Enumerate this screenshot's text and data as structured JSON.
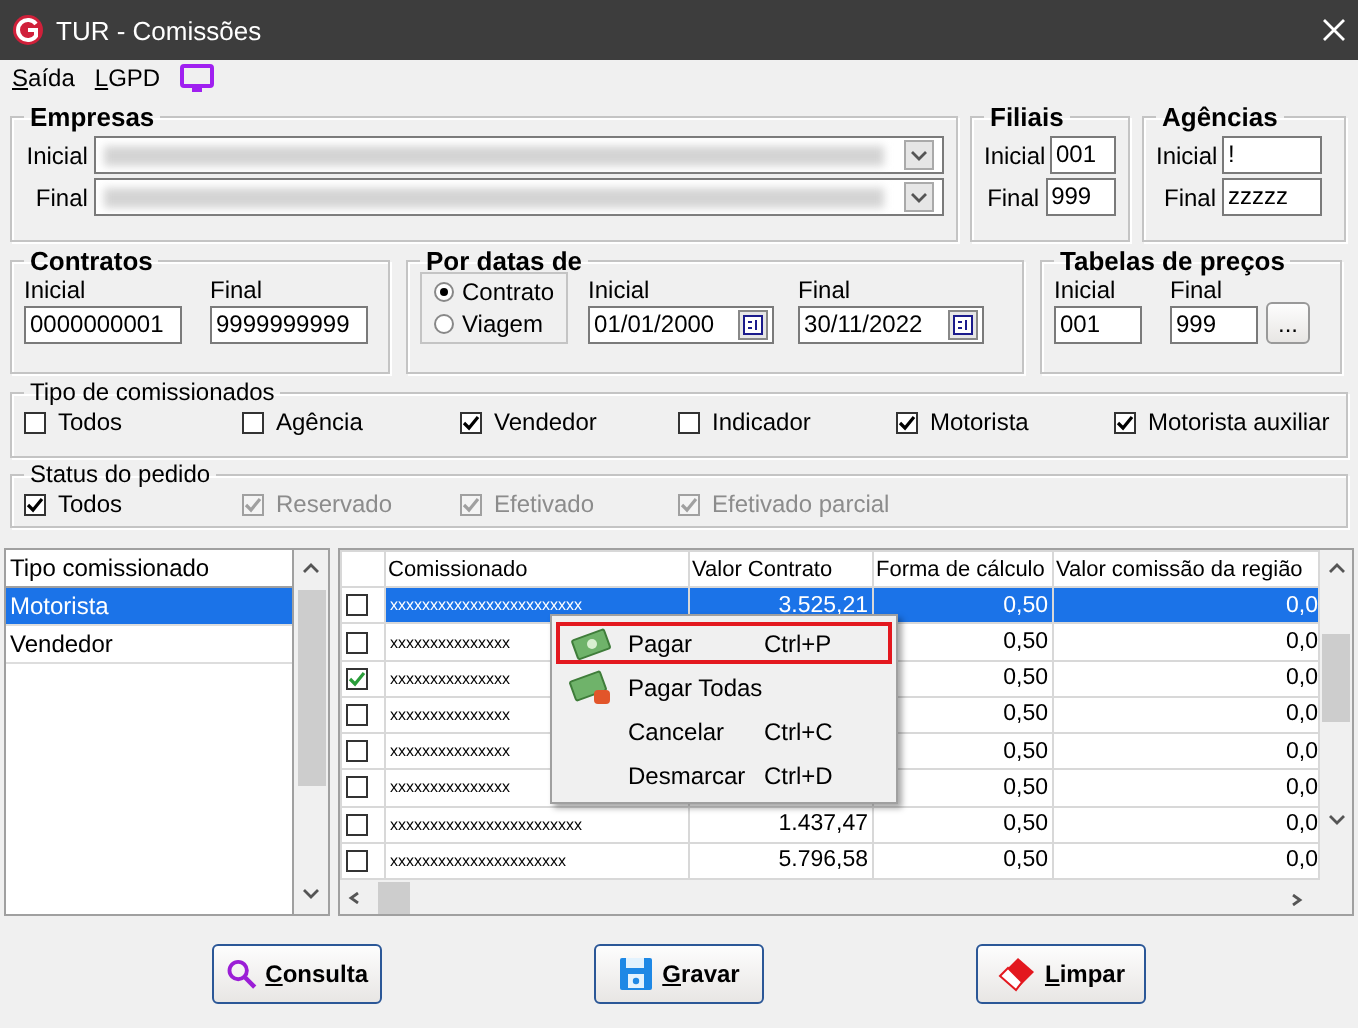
{
  "window": {
    "title": "TUR - Comissões"
  },
  "menu": [
    {
      "label": "Saída"
    },
    {
      "label": "LGPD"
    }
  ],
  "empresas": {
    "title": "Empresas",
    "fields": [
      {
        "label": "Inicial"
      },
      {
        "label": "Final"
      }
    ]
  },
  "filiais": {
    "title": "Filiais",
    "fields": [
      {
        "label": "Inicial",
        "value": "001"
      },
      {
        "label": "Final",
        "value": "999"
      }
    ]
  },
  "agencias": {
    "title": "Agências",
    "fields": [
      {
        "label": "Inicial",
        "value": "!"
      },
      {
        "label": "Final",
        "value": "zzzzz"
      }
    ]
  },
  "contratos": {
    "title": "Contratos",
    "fields": [
      {
        "label": "Inicial",
        "value": "0000000001"
      },
      {
        "label": "Final",
        "value": "9999999999"
      }
    ]
  },
  "por_datas": {
    "title": "Por datas de",
    "options": [
      {
        "label": "Contrato",
        "selected": true
      },
      {
        "label": "Viagem",
        "selected": false
      }
    ],
    "fields": [
      {
        "label": "Inicial",
        "value": "01/01/2000"
      },
      {
        "label": "Final",
        "value": "30/11/2022"
      }
    ]
  },
  "tabelas": {
    "title": "Tabelas de preços",
    "fields": [
      {
        "label": "Inicial",
        "value": "001"
      },
      {
        "label": "Final",
        "value": "999"
      }
    ],
    "button": "..."
  },
  "tipo": {
    "title": "Tipo de comissionados",
    "options": [
      {
        "label": "Todos",
        "checked": false
      },
      {
        "label": "Agência",
        "checked": false
      },
      {
        "label": "Vendedor",
        "checked": true
      },
      {
        "label": "Indicador",
        "checked": false
      },
      {
        "label": "Motorista",
        "checked": true
      },
      {
        "label": "Motorista auxiliar",
        "checked": true
      }
    ]
  },
  "status": {
    "title": "Status do pedido",
    "options": [
      {
        "label": "Todos",
        "checked": true,
        "disabled": false
      },
      {
        "label": "Reservado",
        "checked": true,
        "disabled": true
      },
      {
        "label": "Efetivado",
        "checked": true,
        "disabled": true
      },
      {
        "label": "Efetivado parcial",
        "checked": true,
        "disabled": true
      }
    ]
  },
  "left_list": {
    "header": "Tipo comissionado",
    "items": [
      {
        "label": "Motorista",
        "selected": true
      },
      {
        "label": "Vendedor",
        "selected": false
      }
    ]
  },
  "grid": {
    "columns": [
      "Comissionado",
      "Valor Contrato",
      "Forma de cálculo",
      "Valor comissão da região"
    ],
    "rows": [
      {
        "checked": false,
        "selected": true,
        "comissionado": "xxxxxxxxxxxxxxxxxxxxxxxx",
        "valor": "3.525,21",
        "forma": "0,50",
        "regiao": "0,0"
      },
      {
        "checked": false,
        "selected": false,
        "comissionado": "xxxxxxxxxxxxxxx",
        "forma": "0,50",
        "regiao": "0,0"
      },
      {
        "checked": true,
        "selected": false,
        "comissionado": "xxxxxxxxxxxxxxx",
        "forma": "0,50",
        "regiao": "0,0"
      },
      {
        "checked": false,
        "selected": false,
        "comissionado": "xxxxxxxxxxxxxxx",
        "forma": "0,50",
        "regiao": "0,0"
      },
      {
        "checked": false,
        "selected": false,
        "comissionado": "xxxxxxxxxxxxxxx",
        "forma": "0,50",
        "regiao": "0,0"
      },
      {
        "checked": false,
        "selected": false,
        "comissionado": "xxxxxxxxxxxxxxx",
        "forma": "0,50",
        "regiao": "0,0"
      },
      {
        "checked": false,
        "selected": false,
        "comissionado": "xxxxxxxxxxxxxxxxxxxxxxxx",
        "valor": "1.437,47",
        "forma": "0,50",
        "regiao": "0,0"
      },
      {
        "checked": false,
        "selected": false,
        "comissionado": "xxxxxxxxxxxxxxxxxxxxxx",
        "valor": "5.796,58",
        "forma": "0,50",
        "regiao": "0,0"
      }
    ]
  },
  "context_menu": {
    "items": [
      {
        "label": "Pagar",
        "shortcut": "Ctrl+P",
        "kind": "pay",
        "selected": true
      },
      {
        "label": "Pagar Todas",
        "kind": "pay_all",
        "selected": false
      },
      {
        "label": "Cancelar",
        "shortcut": "Ctrl+C",
        "kind": "plain",
        "selected": false
      },
      {
        "label": "Desmarcar",
        "shortcut": "Ctrl+D",
        "kind": "plain",
        "selected": false
      }
    ]
  },
  "buttons": [
    {
      "label": "Consulta",
      "kind": "search"
    },
    {
      "label": "Gravar",
      "kind": "save"
    },
    {
      "label": "Limpar",
      "kind": "clear"
    }
  ]
}
